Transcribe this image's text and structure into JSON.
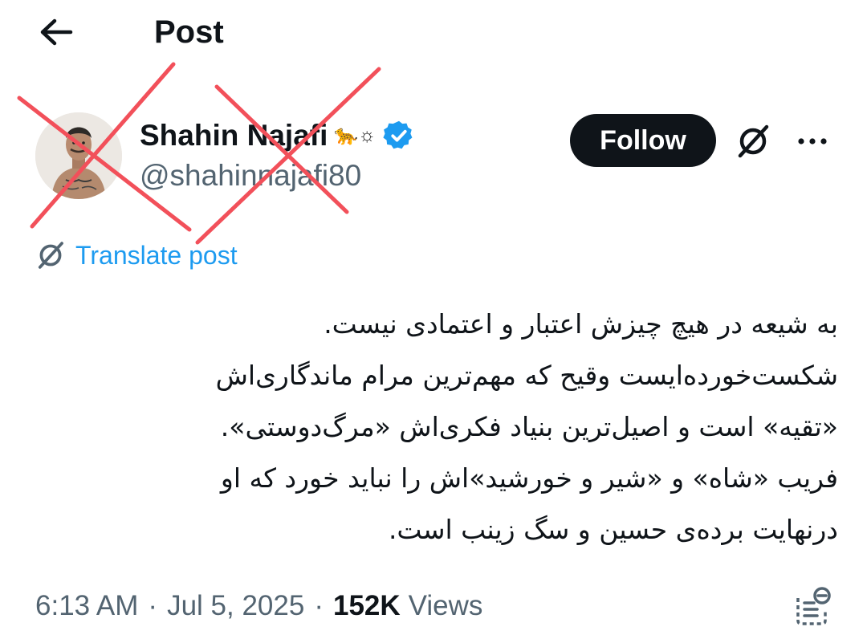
{
  "header": {
    "title": "Post",
    "back_icon": "arrow-left-icon"
  },
  "author": {
    "display_name": "Shahin Najafi",
    "name_emoji": "🐆☼",
    "handle": "@shahinnajafi80",
    "verified": true,
    "verified_color": "#1d9bf0",
    "avatar_icon": "avatar-photo"
  },
  "actions": {
    "follow_label": "Follow",
    "grok_icon": "grok-icon",
    "more_icon": "more-dots-icon"
  },
  "translate": {
    "label": "Translate post",
    "icon": "grok-icon"
  },
  "post": {
    "lines": [
      "به شیعه در هیچ چیزش اعتبار و اعتمادی نیست.",
      "شکست‌خورده‌ایست وقیح که مهم‌ترین مرام ماندگاری‌اش",
      "«تقیه» است و اصیل‌ترین بنیاد فکری‌اش «مرگ‌دوستی».",
      "فریب «شاه» و «شیر و خورشید»اش را نباید خورد که او",
      "درنهایت برده‌ی حسین و سگ زینب است."
    ]
  },
  "meta": {
    "time": "6:13 AM",
    "date": "Jul 5, 2025",
    "separator": "·",
    "views_count": "152K",
    "views_label": "Views"
  },
  "colors": {
    "accent": "#1d9bf0",
    "text": "#0f1419",
    "muted": "#536471",
    "x_mark": "#f2505a"
  }
}
